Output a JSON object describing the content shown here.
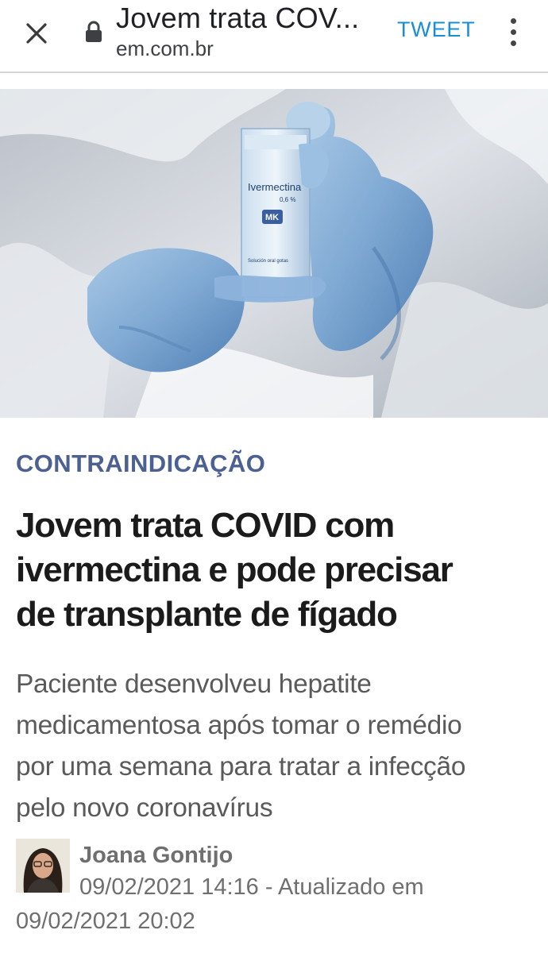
{
  "browser": {
    "page_title": "Jovem trata COV...",
    "domain": "em.com.br",
    "tweet_label": "TWEET",
    "icons": {
      "close": "close-icon",
      "lock": "lock-icon",
      "menu": "more-vert-icon"
    }
  },
  "hero": {
    "bottle_label": "Ivermectina",
    "bottle_concentration": "0,6 %",
    "bottle_brand": "MK",
    "bottle_subtext": "Solución oral gotas"
  },
  "article": {
    "kicker": "CONTRAINDICAÇÃO",
    "headline_lines": [
      "Jovem trata COVID com",
      "ivermectina e pode precisar",
      "de transplante de fígado"
    ],
    "subhead_lines": [
      "Paciente desenvolveu hepatite",
      "medicamentosa após tomar o remédio",
      "por uma semana para tratar a infecção",
      "pelo novo coronavírus"
    ],
    "author": "Joana Gontijo",
    "published_line": "09/02/2021 14:16 - Atualizado em",
    "updated_line": "09/02/2021 20:02"
  },
  "colors": {
    "kicker": "#4c6191",
    "tweet": "#1a8cd8",
    "headline": "#1b1b1b",
    "subhead": "#5a5a5a",
    "meta": "#6f6f6f"
  }
}
